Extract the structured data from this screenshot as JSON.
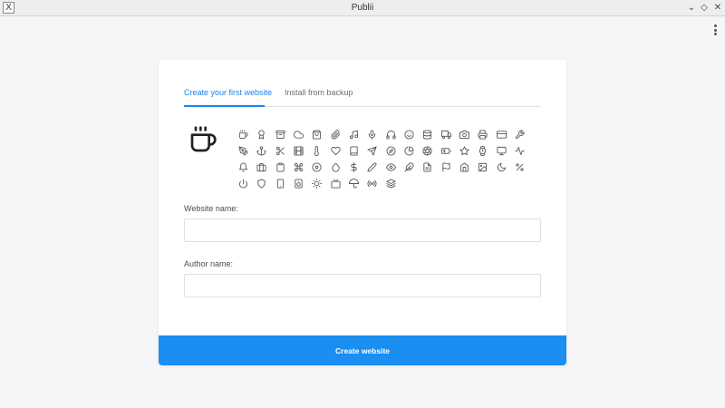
{
  "window": {
    "title": "Publii",
    "app_icon_glyph": "X",
    "controls": {
      "minimize": "⌄",
      "maximize": "◇",
      "close": "✕"
    }
  },
  "tabs": [
    {
      "label": "Create your first website",
      "active": true
    },
    {
      "label": "Install from backup",
      "active": false
    }
  ],
  "selected_icon": "coffee-icon",
  "icons": [
    "coffee-icon",
    "award-icon",
    "archive-icon",
    "cloud-icon",
    "shopping-bag-icon",
    "paperclip-icon",
    "music-icon",
    "mic-icon",
    "headphones-icon",
    "smile-icon",
    "database-icon",
    "truck-icon",
    "camera-icon",
    "printer-icon",
    "credit-card-icon",
    "tool-icon",
    "pen-tool-icon",
    "anchor-icon",
    "scissors-icon",
    "film-icon",
    "thermometer-icon",
    "heart-icon",
    "book-icon",
    "send-icon",
    "compass-icon",
    "pie-chart-icon",
    "aperture-icon",
    "battery-icon",
    "star-icon",
    "watch-icon",
    "monitor-icon",
    "activity-icon",
    "bell-icon",
    "briefcase-icon",
    "clipboard-icon",
    "command-icon",
    "disc-icon",
    "droplet-icon",
    "dollar-icon",
    "pencil-icon",
    "eye-icon",
    "feather-icon",
    "file-text-icon",
    "flag-icon",
    "home-icon",
    "image-icon",
    "moon-icon",
    "percent-icon",
    "power-icon",
    "shield-icon",
    "smartphone-icon",
    "speaker-icon",
    "sun-icon",
    "tv-icon",
    "umbrella-icon",
    "radio-icon",
    "layers-icon"
  ],
  "form": {
    "website_name_label": "Website name:",
    "website_name_value": "",
    "author_name_label": "Author name:",
    "author_name_value": "",
    "submit_label": "Create website"
  },
  "colors": {
    "accent": "#1f80e8",
    "button": "#1b8ef2",
    "icon_stroke": "#555a60"
  }
}
